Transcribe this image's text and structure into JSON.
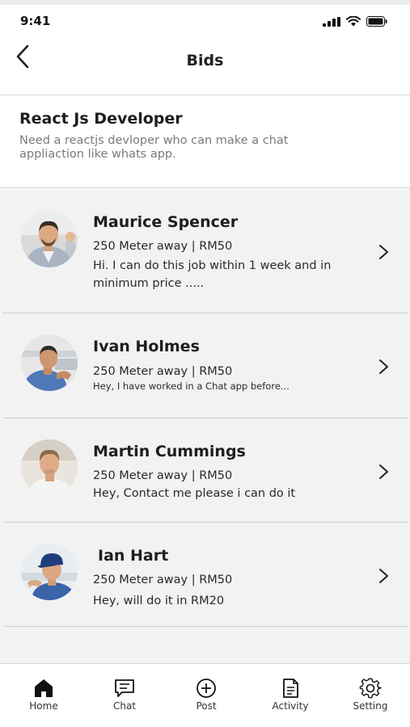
{
  "status_bar": {
    "time": "9:41"
  },
  "nav": {
    "title": "Bids"
  },
  "job": {
    "title": "React Js Developer",
    "description": "Need a reactjs devloper who can make a chat appliaction like whats app."
  },
  "bids": [
    {
      "name": "Maurice Spencer",
      "meta": "250 Meter away | RM50",
      "message": "Hi. I can do this job within 1 week and in minimum price ....."
    },
    {
      "name": "Ivan Holmes",
      "meta": "250 Meter away | RM50",
      "message": "Hey, I have worked in a Chat app before..."
    },
    {
      "name": "Martin Cummings",
      "meta": "250 Meter away | RM50",
      "message": "Hey, Contact me please i can do it"
    },
    {
      "name": "Ian Hart",
      "meta": "250 Meter away | RM50",
      "message": "Hey, will do it in RM20"
    }
  ],
  "tabs": [
    {
      "label": "Home",
      "icon": "home-icon",
      "active": true
    },
    {
      "label": "Chat",
      "icon": "chat-icon"
    },
    {
      "label": "Post",
      "icon": "plus-circle-icon"
    },
    {
      "label": "Activity",
      "icon": "document-icon"
    },
    {
      "label": "Setting",
      "icon": "gear-icon"
    }
  ],
  "colors": {
    "list_background": "#f2f2f2",
    "text": "#1e1e1e",
    "muted": "#7a7a7a",
    "divider": "#cfcfcf"
  }
}
